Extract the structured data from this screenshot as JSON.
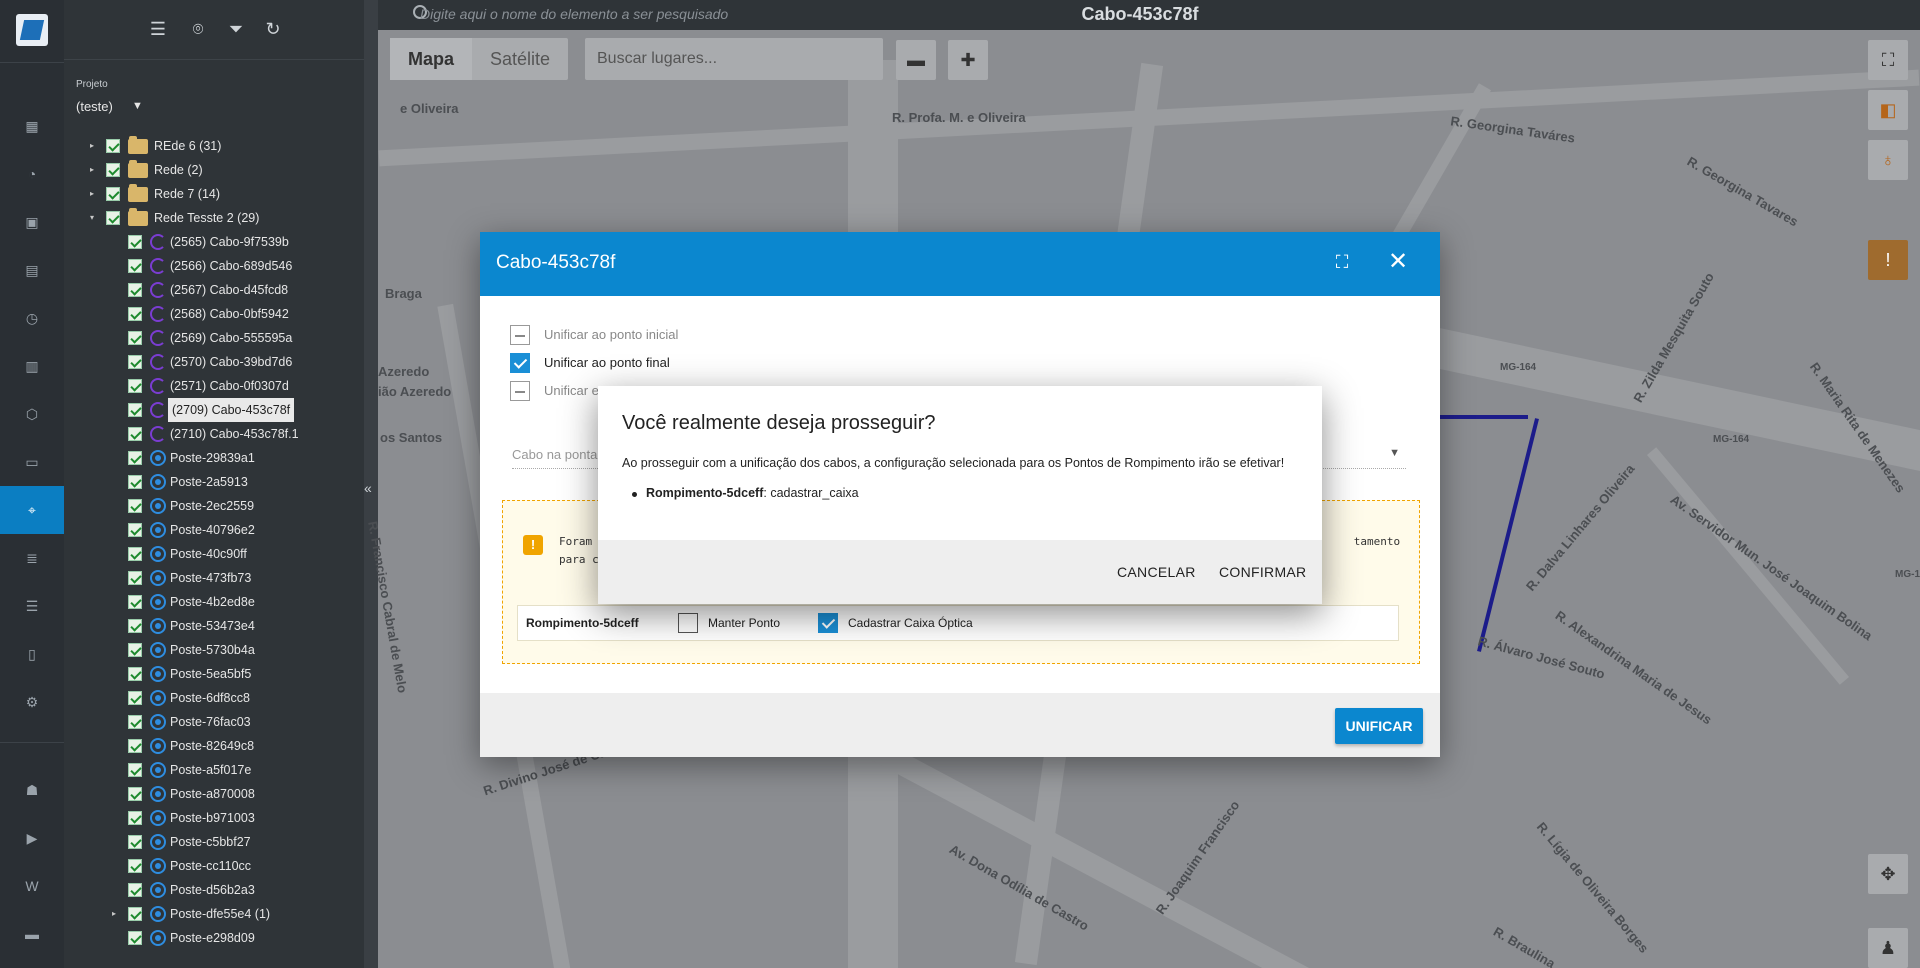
{
  "rail": {
    "items": [
      {
        "name": "dashboard-icon",
        "glyph": "▦"
      },
      {
        "name": "network-icon",
        "glyph": "◔"
      },
      {
        "name": "contacts-icon",
        "glyph": "▣"
      },
      {
        "name": "map-book-icon",
        "glyph": "▤"
      },
      {
        "name": "calendar-icon",
        "glyph": "◷"
      },
      {
        "name": "building-icon",
        "glyph": "▥"
      },
      {
        "name": "box-icon",
        "glyph": "⬡"
      },
      {
        "name": "money-icon",
        "glyph": "▭"
      },
      {
        "name": "map-pin-icon",
        "glyph": "⌖"
      },
      {
        "name": "list-icon",
        "glyph": "≣"
      },
      {
        "name": "table-icon",
        "glyph": "☰"
      },
      {
        "name": "document-icon",
        "glyph": "▯"
      },
      {
        "name": "settings-icon",
        "glyph": "⚙"
      },
      {
        "name": "android-icon",
        "glyph": "☗"
      },
      {
        "name": "video-icon",
        "glyph": "▶"
      },
      {
        "name": "wiki-icon",
        "glyph": "W"
      },
      {
        "name": "chat-icon",
        "glyph": "▬"
      }
    ]
  },
  "panel": {
    "toolbar": {
      "menu": "☰",
      "location": "⌾",
      "filter": "⏷",
      "refresh": "↻"
    },
    "project_label": "Projeto",
    "project_value": "(teste)",
    "project_caret": "▼",
    "collapse": "«",
    "tree": [
      {
        "indent": 1,
        "arrow": "▸",
        "type": "folder",
        "label": "REde 6 (31)"
      },
      {
        "indent": 1,
        "arrow": "▸",
        "type": "folder",
        "label": "Rede (2)"
      },
      {
        "indent": 1,
        "arrow": "▸",
        "type": "folder",
        "label": "Rede 7 (14)"
      },
      {
        "indent": 1,
        "arrow": "▾",
        "type": "folder",
        "label": "Rede Tesste 2 (29)"
      },
      {
        "indent": 2,
        "arrow": "",
        "type": "cabo",
        "label": "(2565) Cabo-9f7539b"
      },
      {
        "indent": 2,
        "arrow": "",
        "type": "cabo",
        "label": "(2566) Cabo-689d546"
      },
      {
        "indent": 2,
        "arrow": "",
        "type": "cabo",
        "label": "(2567) Cabo-d45fcd8"
      },
      {
        "indent": 2,
        "arrow": "",
        "type": "cabo",
        "label": "(2568) Cabo-0bf5942"
      },
      {
        "indent": 2,
        "arrow": "",
        "type": "cabo",
        "label": "(2569) Cabo-555595a"
      },
      {
        "indent": 2,
        "arrow": "",
        "type": "cabo",
        "label": "(2570) Cabo-39bd7d6"
      },
      {
        "indent": 2,
        "arrow": "",
        "type": "cabo",
        "label": "(2571) Cabo-0f0307d"
      },
      {
        "indent": 2,
        "arrow": "",
        "type": "cabo",
        "label": "(2709) Cabo-453c78f",
        "selected": true
      },
      {
        "indent": 2,
        "arrow": "",
        "type": "cabo",
        "label": "(2710) Cabo-453c78f.1"
      },
      {
        "indent": 2,
        "arrow": "",
        "type": "poste",
        "label": "Poste-29839a1"
      },
      {
        "indent": 2,
        "arrow": "",
        "type": "poste",
        "label": "Poste-2a5913"
      },
      {
        "indent": 2,
        "arrow": "",
        "type": "poste",
        "label": "Poste-2ec2559"
      },
      {
        "indent": 2,
        "arrow": "",
        "type": "poste",
        "label": "Poste-40796e2"
      },
      {
        "indent": 2,
        "arrow": "",
        "type": "poste",
        "label": "Poste-40c90ff"
      },
      {
        "indent": 2,
        "arrow": "",
        "type": "poste",
        "label": "Poste-473fb73"
      },
      {
        "indent": 2,
        "arrow": "",
        "type": "poste",
        "label": "Poste-4b2ed8e"
      },
      {
        "indent": 2,
        "arrow": "",
        "type": "poste",
        "label": "Poste-53473e4"
      },
      {
        "indent": 2,
        "arrow": "",
        "type": "poste",
        "label": "Poste-5730b4a"
      },
      {
        "indent": 2,
        "arrow": "",
        "type": "poste",
        "label": "Poste-5ea5bf5"
      },
      {
        "indent": 2,
        "arrow": "",
        "type": "poste",
        "label": "Poste-6df8cc8"
      },
      {
        "indent": 2,
        "arrow": "",
        "type": "poste",
        "label": "Poste-76fac03"
      },
      {
        "indent": 2,
        "arrow": "",
        "type": "poste",
        "label": "Poste-82649c8"
      },
      {
        "indent": 2,
        "arrow": "",
        "type": "poste",
        "label": "Poste-a5f017e"
      },
      {
        "indent": 2,
        "arrow": "",
        "type": "poste",
        "label": "Poste-a870008"
      },
      {
        "indent": 2,
        "arrow": "",
        "type": "poste",
        "label": "Poste-b971003"
      },
      {
        "indent": 2,
        "arrow": "",
        "type": "poste",
        "label": "Poste-c5bbf27"
      },
      {
        "indent": 2,
        "arrow": "",
        "type": "poste",
        "label": "Poste-cc110cc"
      },
      {
        "indent": 2,
        "arrow": "",
        "type": "poste",
        "label": "Poste-d56b2a3"
      },
      {
        "indent": 2,
        "arrow": "▸",
        "type": "poste",
        "label": "Poste-dfe55e4 (1)"
      },
      {
        "indent": 2,
        "arrow": "",
        "type": "poste",
        "label": "Poste-e298d09"
      }
    ]
  },
  "map": {
    "search_placeholder": "Digite aqui o nome do elemento a ser pesquisado",
    "title": "Cabo-453c78f",
    "type_map": "Mapa",
    "type_satellite": "Satélite",
    "places_placeholder": "Buscar lugares...",
    "streets": [
      "R. Profa. M. e Oliveira",
      "R. Georgina Taváres",
      "R. Georgina Tavares",
      "e Oliveira",
      "Braga",
      "Azeredo",
      "ião Azeredo",
      "os Santos",
      "R. Francisco Cabral de Melo",
      "R. Zilda Mesquita Souto",
      "R. Dalva Linhares Oliveira",
      "R. Maria Rita de Menezes",
      "Av. Servidor Mun. José Joaquim Bolina",
      "R. Alexandrina Maria de Jesus",
      "R. Álvaro José Souto",
      "R. Divino José de Castro",
      "Av. Dona Odília de Castro",
      "R. Joaquim Francisco",
      "R. Lígia de Oliveira Borges",
      "R. Braulina",
      "MG-164",
      "MG-164",
      "MG-1"
    ]
  },
  "dialog": {
    "title": "Cabo-453c78f",
    "option_initial": "Unificar ao ponto inicial",
    "option_final": "Unificar ao ponto final",
    "option_third": "Unificar e",
    "select_placeholder": "Cabo na ponta",
    "warning_text": "Foram                                                                                                                   tamento\npara c",
    "rompimento_name": "Rompimento-5dceff",
    "keep_point": "Manter Ponto",
    "register_box": "Cadastrar Caixa Óptica",
    "unify_button": "UNIFICAR"
  },
  "confirm": {
    "title": "Você realmente deseja prosseguir?",
    "message": "Ao prosseguir com a unificação dos cabos, a configuração selecionada para os Pontos de Rompimento irão se efetivar!",
    "item_name": "Rompimento-5dceff",
    "item_value": ": cadastrar_caixa",
    "cancel": "CANCELAR",
    "confirm": "CONFIRMAR"
  },
  "colors": {
    "accent": "#0b87cf",
    "rail_bg": "#2a2f34",
    "warning": "#f0a400",
    "route": "#1c1c8a"
  }
}
